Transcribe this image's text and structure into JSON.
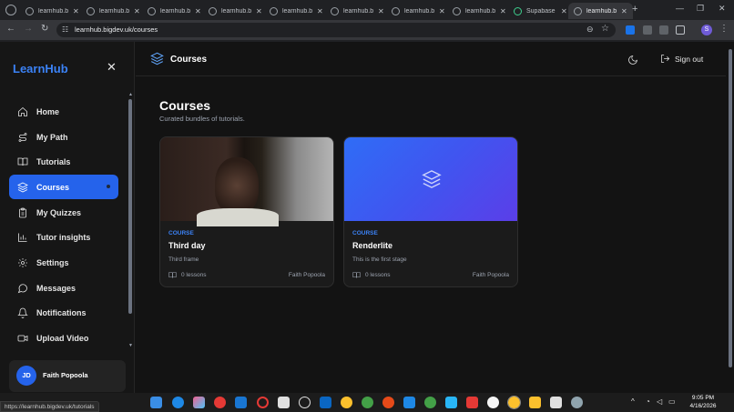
{
  "browser": {
    "tabs": [
      {
        "label": "learnhub.b",
        "active": false
      },
      {
        "label": "learnhub.b",
        "active": false
      },
      {
        "label": "learnhub.b",
        "active": false
      },
      {
        "label": "learnhub.b",
        "active": false
      },
      {
        "label": "learnhub.b",
        "active": false
      },
      {
        "label": "learnhub.b",
        "active": false
      },
      {
        "label": "learnhub.b",
        "active": false
      },
      {
        "label": "learnhub.b",
        "active": false
      },
      {
        "label": "Supabase",
        "active": false
      },
      {
        "label": "learnhub.b",
        "active": true
      }
    ],
    "url": "learnhub.bigdev.uk/courses",
    "profile_initial": "S",
    "status_url": "https://learnhub.bigdev.uk/tutorials"
  },
  "sidebar": {
    "logo": "LearnHub",
    "items": [
      {
        "label": "Home",
        "icon": "home-icon"
      },
      {
        "label": "My Path",
        "icon": "path-icon"
      },
      {
        "label": "Tutorials",
        "icon": "book-icon"
      },
      {
        "label": "Courses",
        "icon": "layers-icon",
        "active": true
      },
      {
        "label": "My Quizzes",
        "icon": "clipboard-icon"
      },
      {
        "label": "Tutor insights",
        "icon": "bar-chart-icon"
      },
      {
        "label": "Settings",
        "icon": "gear-icon"
      },
      {
        "label": "Messages",
        "icon": "message-icon"
      },
      {
        "label": "Notifications",
        "icon": "bell-icon"
      },
      {
        "label": "Upload Video",
        "icon": "video-icon"
      }
    ],
    "user": {
      "initials": "JD",
      "name": "Faith Popoola"
    }
  },
  "topbar": {
    "title": "Courses",
    "sign_out": "Sign out"
  },
  "page": {
    "title": "Courses",
    "subtitle": "Curated bundles of tutorials."
  },
  "courses": [
    {
      "tag": "COURSE",
      "title": "Third day",
      "description": "Third frame",
      "lessons": "0 lessons",
      "author": "Faith Popoola"
    },
    {
      "tag": "COURSE",
      "title": "Renderlite",
      "description": "This is the first stage",
      "lessons": "0 lessons",
      "author": "Faith Popoola"
    }
  ],
  "taskbar": {
    "time": "9:05 PM",
    "date": "4/16/2026"
  },
  "colors": {
    "accent": "#2563eb",
    "background": "#131313",
    "sidebar": "#161616"
  }
}
